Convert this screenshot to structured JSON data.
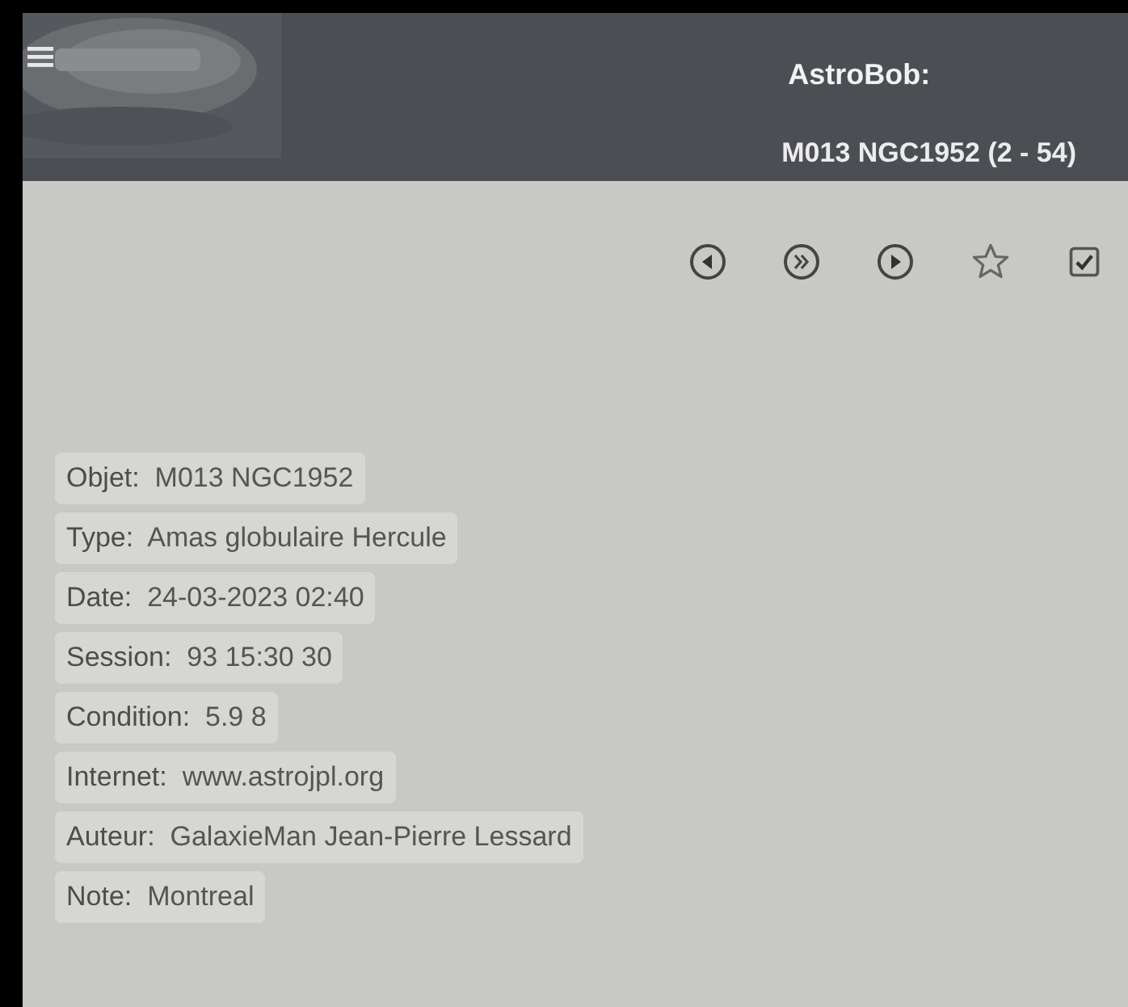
{
  "header": {
    "title": "AstroBob:",
    "subtitle": "M013 NGC1952 (2 - 54)"
  },
  "toolbar": {
    "favorite": false,
    "checked": true
  },
  "fields": [
    {
      "label": "Objet:",
      "value": "M013 NGC1952"
    },
    {
      "label": "Type:",
      "value": "Amas globulaire Hercule"
    },
    {
      "label": "Date:",
      "value": "24-03-2023 02:40"
    },
    {
      "label": "Session:",
      "value": "93 15:30 30"
    },
    {
      "label": "Condition:",
      "value": "5.9 8"
    },
    {
      "label": "Internet:",
      "value": "www.astrojpl.org"
    },
    {
      "label": "Auteur:",
      "value": "GalaxieMan Jean-Pierre Lessard"
    },
    {
      "label": "Note:",
      "value": "Montreal"
    }
  ]
}
